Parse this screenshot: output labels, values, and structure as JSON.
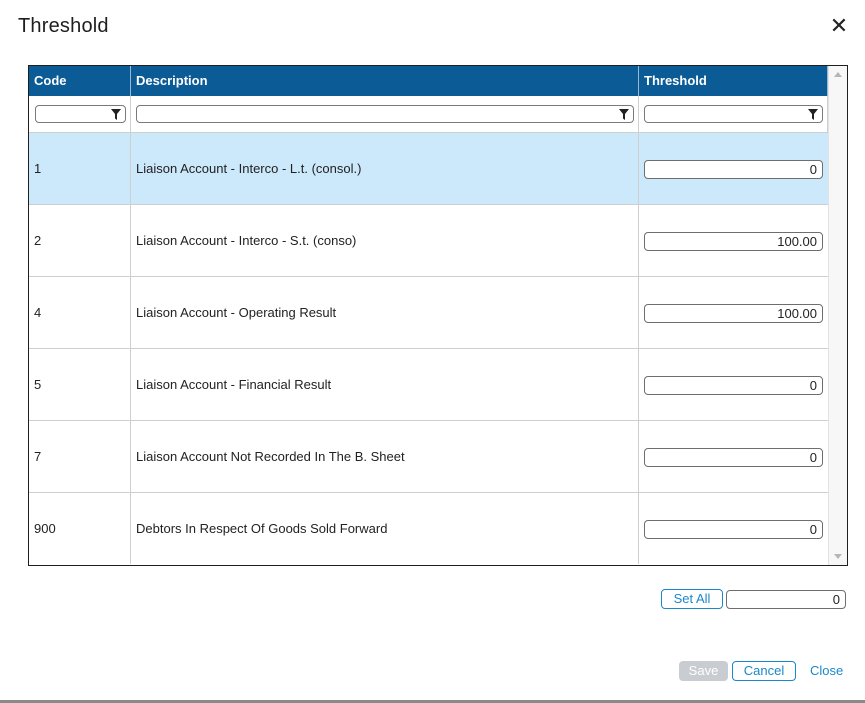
{
  "dialog": {
    "title": "Threshold",
    "close_icon": "close-icon"
  },
  "grid": {
    "columns": [
      {
        "label": "Code"
      },
      {
        "label": "Description"
      },
      {
        "label": "Threshold"
      }
    ],
    "filter_icon": "funnel-icon",
    "rows": [
      {
        "code": "1",
        "description": "Liaison Account - Interco - L.t. (consol.)",
        "threshold": "0",
        "selected": true
      },
      {
        "code": "2",
        "description": "Liaison Account - Interco - S.t. (conso)",
        "threshold": "100.00",
        "selected": false
      },
      {
        "code": "4",
        "description": "Liaison Account - Operating Result",
        "threshold": "100.00",
        "selected": false
      },
      {
        "code": "5",
        "description": "Liaison Account - Financial Result",
        "threshold": "0",
        "selected": false
      },
      {
        "code": "7",
        "description": "Liaison Account Not Recorded In The B. Sheet",
        "threshold": "0",
        "selected": false
      },
      {
        "code": "900",
        "description": "Debtors In Respect Of Goods Sold Forward",
        "threshold": "0",
        "selected": false
      }
    ]
  },
  "set_all": {
    "label": "Set All",
    "value": "0"
  },
  "footer": {
    "save_label": "Save",
    "cancel_label": "Cancel",
    "close_label": "Close"
  },
  "colors": {
    "header_bg": "#0b5b96",
    "selected_row_bg": "#cce8fb",
    "accent": "#1a88c9"
  }
}
